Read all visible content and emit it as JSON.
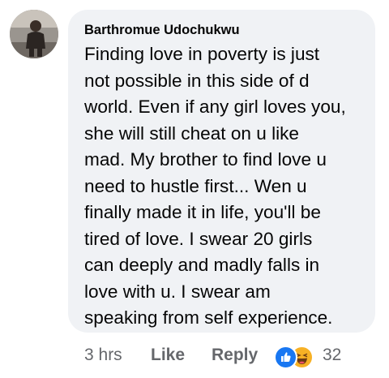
{
  "comment": {
    "author": "Barthromue Udochukwu",
    "lines": [
      "Finding love in poverty is just",
      "not possible in this side of d",
      "world. Even if any girl loves you,",
      "she will still cheat on u like",
      "mad. My brother to find love u",
      "need to hustle first... Wen u",
      "finally made it in life, you'll be",
      "tired of love. I swear 20 girls",
      "can deeply and madly falls in",
      "love with u. I swear am",
      "speaking from self experience."
    ]
  },
  "actions": {
    "time": "3 hrs",
    "like_label": "Like",
    "reply_label": "Reply",
    "reaction_icons": [
      "like-icon",
      "haha-icon"
    ],
    "reaction_count": "32"
  },
  "colors": {
    "bubble_bg": "#f0f2f5",
    "text": "#050505",
    "secondary_text": "#65676b",
    "like_blue": "#1877f2",
    "haha_yellow": "#f7b125"
  }
}
